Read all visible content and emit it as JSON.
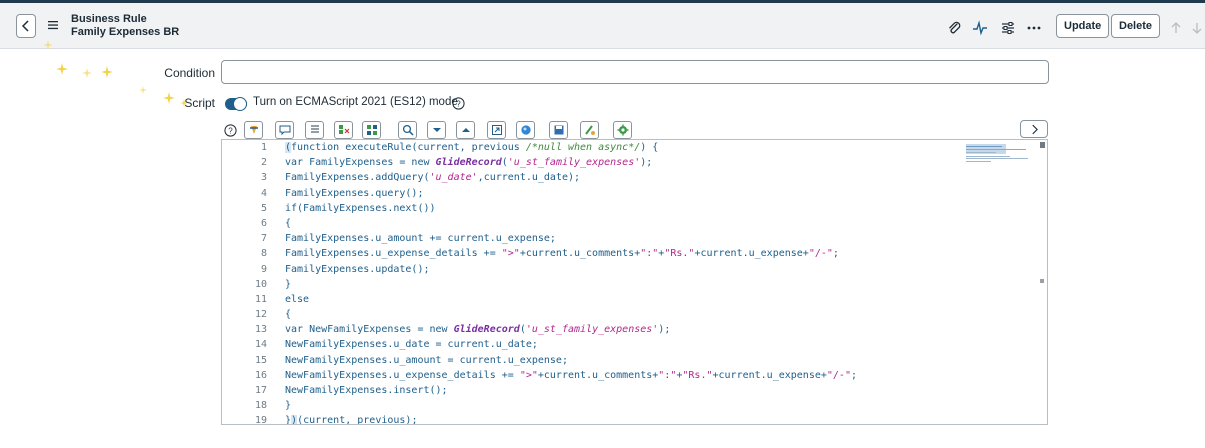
{
  "header": {
    "title": "Business Rule",
    "subtitle": "Family Expenses BR",
    "update_label": "Update",
    "delete_label": "Delete",
    "icons": [
      "back-icon",
      "menu-icon",
      "paperclip-icon",
      "activity-icon",
      "settings-sliders-icon",
      "more-icon",
      "arrow-up-icon",
      "arrow-down-icon"
    ]
  },
  "form": {
    "condition_label": "Condition",
    "condition_value": "",
    "script_label": "Script",
    "ecma_toggle_label": "Turn on ECMAScript 2021 (ES12) mode",
    "ecma_toggle_on": true
  },
  "toolbar": {
    "icons": [
      "help-icon",
      "format-code-icon",
      "comment-icon",
      "toggle-comment-icon",
      "replace-icon",
      "replace-all-icon",
      "search-icon",
      "next-match-icon",
      "prev-match-icon",
      "fullscreen-icon",
      "script-debugger-icon",
      "save-icon",
      "scripts-background-icon",
      "script-include-icon",
      "expand-panel-icon"
    ]
  },
  "editor": {
    "lines": [
      {
        "n": "1",
        "code": "(function executeRule(current, previous /*null when async*/) {"
      },
      {
        "n": "2",
        "code": "var FamilyExpenses = new GlideRecord('u_st_family_expenses');"
      },
      {
        "n": "3",
        "code": "FamilyExpenses.addQuery('u_date',current.u_date);"
      },
      {
        "n": "4",
        "code": "FamilyExpenses.query();"
      },
      {
        "n": "5",
        "code": "if(FamilyExpenses.next())"
      },
      {
        "n": "6",
        "code": "{"
      },
      {
        "n": "7",
        "code": "FamilyExpenses.u_amount += current.u_expense;"
      },
      {
        "n": "8",
        "code": "FamilyExpenses.u_expense_details += \">\"+current.u_comments+\":\"+\"Rs.\"+current.u_expense+\"/-\";"
      },
      {
        "n": "9",
        "code": "FamilyExpenses.update();"
      },
      {
        "n": "10",
        "code": "}"
      },
      {
        "n": "11",
        "code": "else"
      },
      {
        "n": "12",
        "code": "{"
      },
      {
        "n": "13",
        "code": "var NewFamilyExpenses = new GlideRecord('u_st_family_expenses');"
      },
      {
        "n": "14",
        "code": "NewFamilyExpenses.u_date = current.u_date;"
      },
      {
        "n": "15",
        "code": "NewFamilyExpenses.u_amount = current.u_expense;"
      },
      {
        "n": "16",
        "code": "NewFamilyExpenses.u_expense_details += \">\"+current.u_comments+\":\"+\"Rs.\"+current.u_expense+\"/-\";"
      },
      {
        "n": "17",
        "code": "NewFamilyExpenses.insert();"
      },
      {
        "n": "18",
        "code": "}"
      },
      {
        "n": "19",
        "code": "})(current, previous);"
      }
    ]
  },
  "colors": {
    "accent": "#1f5f8b",
    "string": "#b3258d",
    "comment": "#3e8a3e",
    "header_bg": "#f0f2f4",
    "sparkle": "#f2d34a"
  }
}
